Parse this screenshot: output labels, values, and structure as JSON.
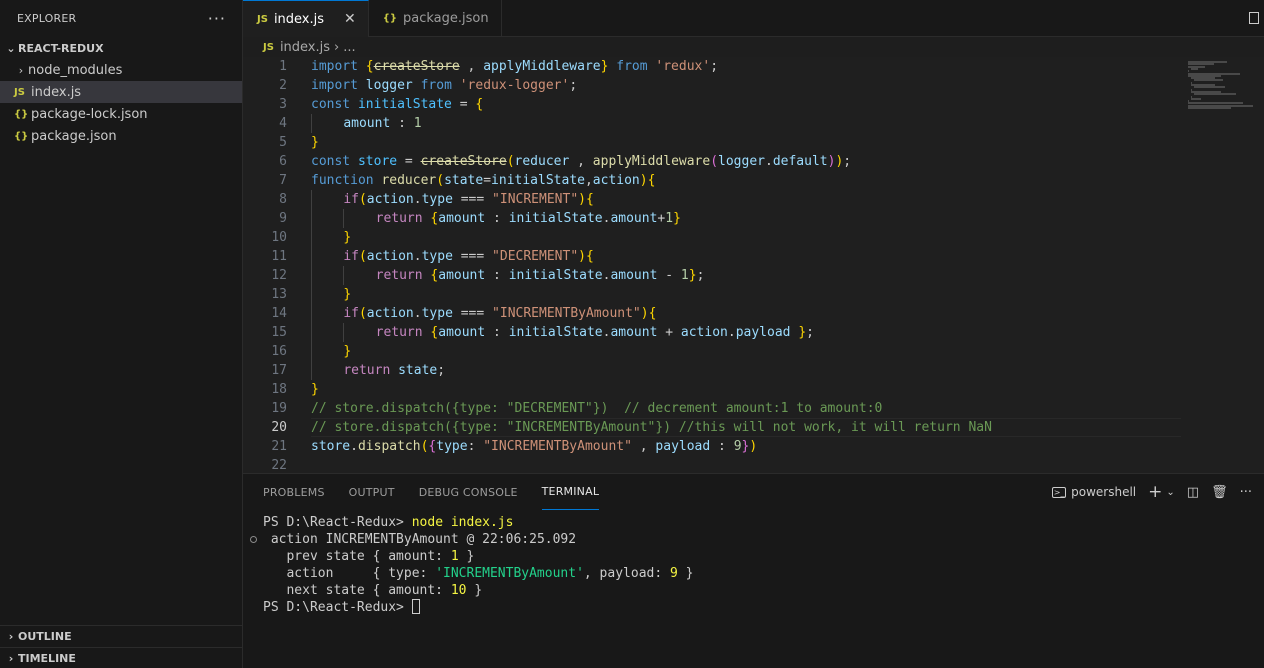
{
  "sidebar": {
    "title": "EXPLORER",
    "more_icon": "ellipsis-icon",
    "project": "REACT-REDUX",
    "items": [
      {
        "label": "node_modules",
        "type": "folder"
      },
      {
        "label": "index.js",
        "type": "js",
        "selected": true
      },
      {
        "label": "package-lock.json",
        "type": "json"
      },
      {
        "label": "package.json",
        "type": "json"
      }
    ],
    "outline": "OUTLINE",
    "timeline": "TIMELINE"
  },
  "tabs": [
    {
      "label": "index.js",
      "icon": "JS",
      "active": true
    },
    {
      "label": "package.json",
      "icon": "{}",
      "active": false
    }
  ],
  "breadcrumb": {
    "file": "index.js",
    "rest": "..."
  },
  "editor": {
    "current_line": 20,
    "line_numbers": [
      "1",
      "2",
      "3",
      "4",
      "5",
      "6",
      "7",
      "8",
      "9",
      "10",
      "11",
      "12",
      "13",
      "14",
      "15",
      "16",
      "17",
      "18",
      "19",
      "20",
      "21",
      "22"
    ],
    "code_lines": [
      "import {createStore , applyMiddleware} from 'redux';",
      "import logger from 'redux-logger';",
      "const initialState = {",
      "    amount : 1",
      "}",
      "const store = createStore(reducer , applyMiddleware(logger.default));",
      "function reducer(state=initialState,action){",
      "    if(action.type === \"INCREMENT\"){",
      "        return {amount : initialState.amount+1}",
      "    }",
      "    if(action.type === \"DECREMENT\"){",
      "        return {amount : initialState.amount - 1};",
      "    }",
      "    if(action.type === \"INCREMENTByAmount\"){",
      "        return {amount : initialState.amount + action.payload };",
      "    }",
      "    return state;",
      "}",
      "// store.dispatch({type: \"DECREMENT\"})  // decrement amount:1 to amount:0",
      "// store.dispatch({type: \"INCREMENTByAmount\"}) //this will not work, it will return NaN",
      "store.dispatch({type: \"INCREMENTByAmount\" , payload : 9})",
      ""
    ]
  },
  "panel": {
    "tabs": [
      "PROBLEMS",
      "OUTPUT",
      "DEBUG CONSOLE",
      "TERMINAL"
    ],
    "active_tab": "TERMINAL",
    "shell": "powershell",
    "terminal": {
      "prompt": "PS D:\\React-Redux> ",
      "command": "node index.js",
      "action_line_prefix": " action INCREMENTByAmount @ ",
      "timestamp": "22:06:25.092",
      "prev_label": "   prev state { amount: ",
      "prev_value": "1",
      "prev_close": " }",
      "action_label": "   action     { type: ",
      "action_type": "'INCREMENTByAmount'",
      "action_mid": ", payload: ",
      "action_payload": "9",
      "action_close": " }",
      "next_label": "   next state { amount: ",
      "next_value": "10",
      "next_close": " }",
      "prompt2": "PS D:\\React-Redux> "
    }
  },
  "colors": {
    "accent": "#0078d4",
    "keyword": "#569cd6",
    "string": "#ce9178",
    "comment": "#6a9955",
    "variable": "#9cdcfe"
  }
}
